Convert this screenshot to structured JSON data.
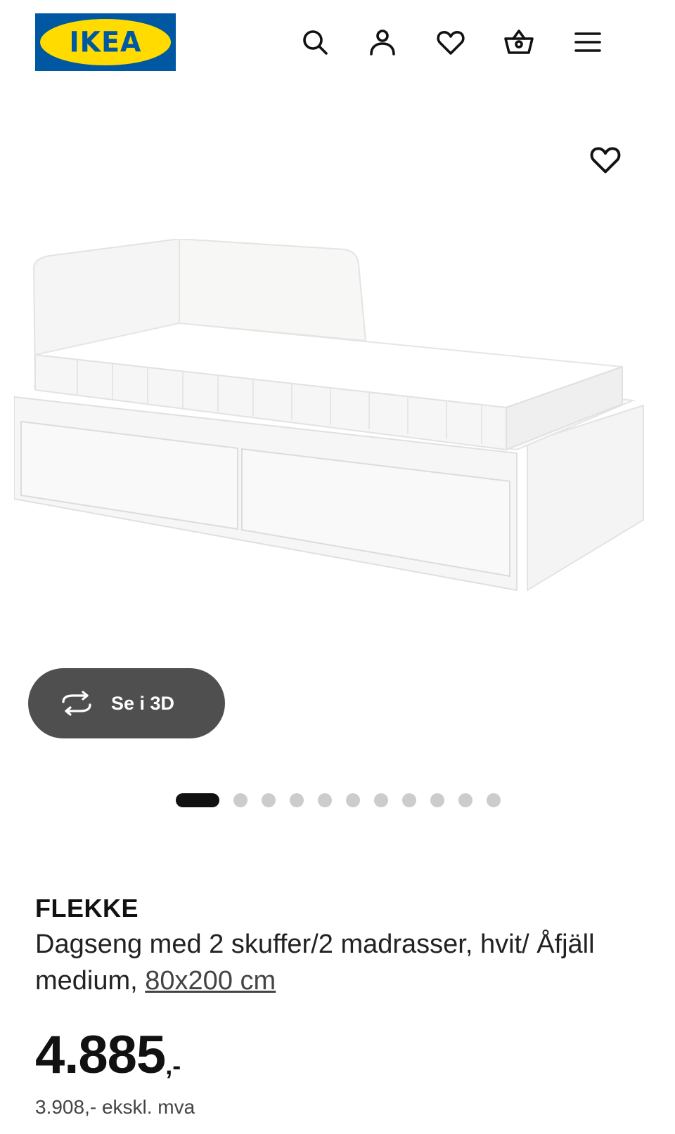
{
  "header": {
    "logo_text": "IKEA",
    "icons": [
      "search-icon",
      "account-icon",
      "favorites-icon",
      "cart-icon",
      "menu-icon"
    ]
  },
  "gallery": {
    "favorite_icon": "heart-icon",
    "view_3d_label": "Se i 3D",
    "total_images": 12,
    "active_index": 0
  },
  "product": {
    "name": "FLEKKE",
    "description": "Dagseng med 2 skuffer/2 madrasser, hvit/ Åfjäll medium, ",
    "size_link": "80x200 cm",
    "price_main": "4.885",
    "price_suffix": ",-",
    "price_ex_vat": "3.908,- ekskl. mva"
  },
  "colors": {
    "ikea_blue": "#0058a3",
    "ikea_yellow": "#ffdb00",
    "button_3d": "#4f4f4f"
  }
}
